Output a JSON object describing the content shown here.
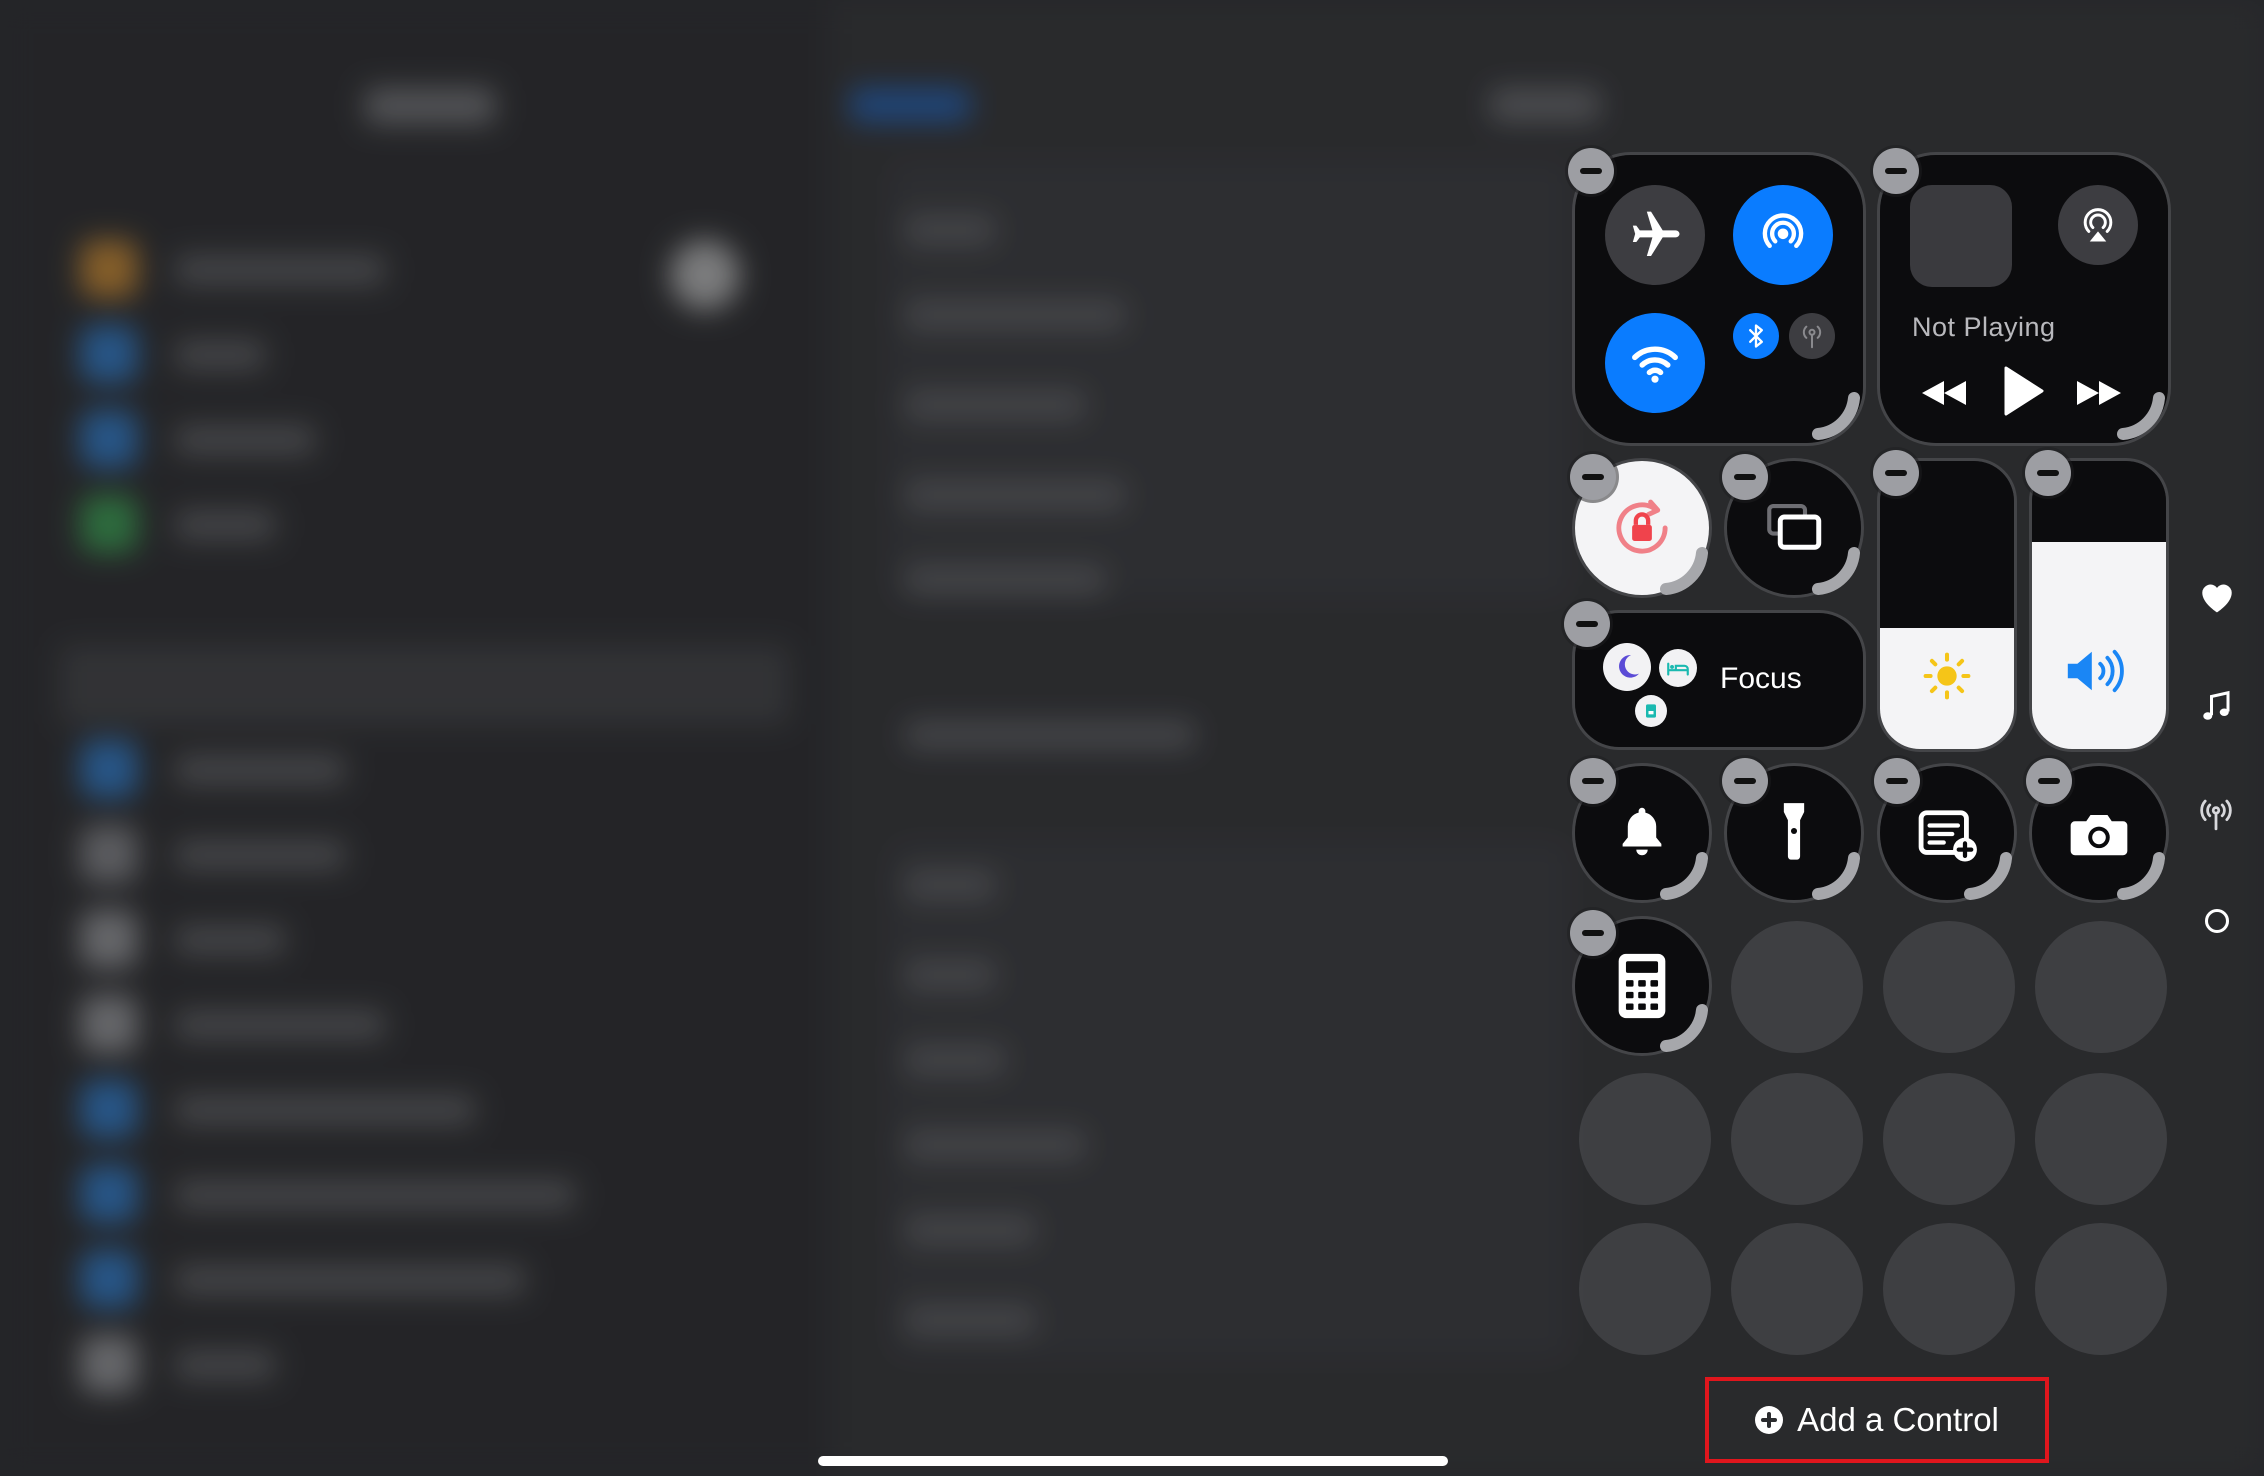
{
  "media": {
    "status": "Not Playing"
  },
  "focus": {
    "label": "Focus"
  },
  "add_control": {
    "label": "Add a Control"
  },
  "icons": {
    "connectivity": [
      "airplane-icon",
      "airdrop-icon",
      "wifi-icon",
      "bluetooth-icon",
      "cellular-icon"
    ],
    "media": [
      "airplay-icon",
      "rewind-icon",
      "play-icon",
      "fast-forward-icon"
    ],
    "controls": [
      "orientation-lock-icon",
      "screen-mirroring-icon",
      "brightness-icon",
      "volume-icon",
      "moon-icon",
      "bed-icon",
      "badge-icon",
      "bell-icon",
      "flashlight-icon",
      "quick-note-icon",
      "camera-icon",
      "calculator-icon"
    ],
    "side_pages": [
      "heart-icon",
      "music-note-icon",
      "antenna-icon",
      "circle-icon"
    ]
  },
  "levels": {
    "brightness": 0.42,
    "volume": 0.72
  },
  "colors": {
    "accent_blue": "#0a7cff",
    "highlight_red": "#e0161d",
    "lock_red": "#f0434c"
  }
}
